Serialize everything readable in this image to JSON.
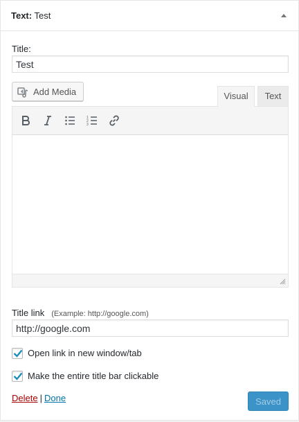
{
  "widget": {
    "title_label": "Text",
    "title_separator": ":",
    "title_name": "Test",
    "toggle_icon": "triangle-up-icon"
  },
  "form": {
    "title_label": "Title:",
    "title_value": "Test",
    "add_media_label": "Add Media",
    "tabs": [
      {
        "label": "Visual",
        "active": true
      },
      {
        "label": "Text",
        "active": false
      }
    ],
    "toolbar": [
      {
        "icon": "bold-icon"
      },
      {
        "icon": "italic-icon"
      },
      {
        "icon": "bulleted-list-icon"
      },
      {
        "icon": "numbered-list-icon"
      },
      {
        "icon": "link-icon"
      }
    ],
    "title_link_label": "Title link",
    "title_link_hint": "(Example: http://google.com)",
    "title_link_value": "http://google.com",
    "checkboxes": [
      {
        "label": "Open link in new window/tab",
        "checked": true
      },
      {
        "label": "Make the entire title bar clickable",
        "checked": true
      }
    ]
  },
  "actions": {
    "delete_label": "Delete",
    "pipe": "|",
    "done_label": "Done",
    "saved_label": "Saved"
  },
  "colors": {
    "accent": "#0073aa",
    "delete": "#a00000",
    "saved_button": "#3b93c8",
    "checkmark": "#1e8cbe"
  }
}
